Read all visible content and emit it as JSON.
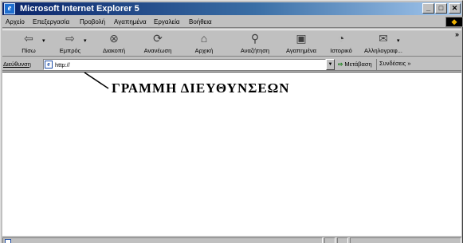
{
  "window": {
    "title": "Microsoft Internet Explorer 5",
    "icon": "ie-page-icon",
    "controls": {
      "minimize": "_",
      "maximize": "□",
      "close": "✕"
    }
  },
  "menu": {
    "items": [
      {
        "label": "Αρχείο"
      },
      {
        "label": "Επεξεργασία"
      },
      {
        "label": "Προβολή"
      },
      {
        "label": "Αγαπημένα"
      },
      {
        "label": "Εργαλεία"
      },
      {
        "label": "Βοήθεια"
      }
    ]
  },
  "toolbar": {
    "buttons": [
      {
        "label": "Πίσω",
        "icon": "back-arrow-icon",
        "glyph": "⇦"
      },
      {
        "label": "Εμπρός",
        "icon": "forward-arrow-icon",
        "glyph": "⇨"
      },
      {
        "label": "Διακοπή",
        "icon": "stop-icon",
        "glyph": "⊗"
      },
      {
        "label": "Ανανέωση",
        "icon": "refresh-icon",
        "glyph": "⟳"
      },
      {
        "label": "Αρχική",
        "icon": "home-icon",
        "glyph": "⌂"
      },
      {
        "label": "Αναζήτηση",
        "icon": "search-icon",
        "glyph": "⚲"
      },
      {
        "label": "Αγαπημένα",
        "icon": "favorites-icon",
        "glyph": "▣"
      },
      {
        "label": "Ιστορικό",
        "icon": "history-icon",
        "glyph": "◔"
      },
      {
        "label": "Αλληλογραφ...",
        "icon": "mail-icon",
        "glyph": "✉"
      }
    ],
    "more": "»"
  },
  "address_bar": {
    "label": "Διεύθυνση",
    "value": "http://",
    "go_label": "Μετάβαση",
    "links_label": "Συνδέσεις »"
  },
  "content": {
    "caption": "ΓΡΑΜΜΗ ΔΙΕΥΘΥΝΣΕΩΝ"
  }
}
